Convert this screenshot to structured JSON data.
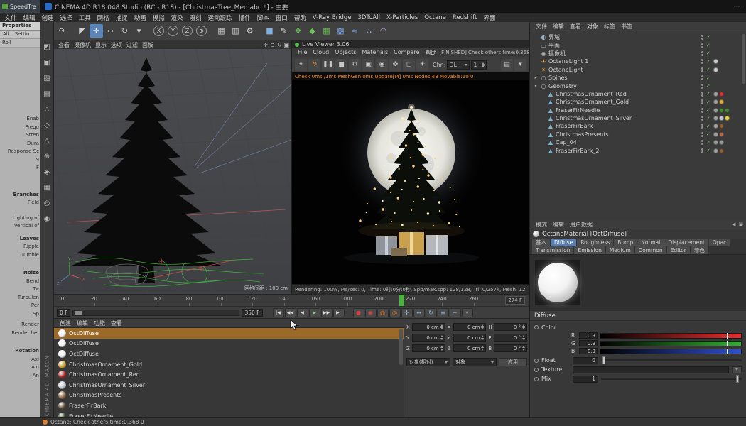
{
  "titlebar": {
    "speedtree_title": "SpeedTre",
    "title": "CINEMA 4D R18.048 Studio (RC - R18) - [ChristmasTree_Med.abc *] - 主要",
    "minimize": "—"
  },
  "menubar": {
    "items": [
      "文件",
      "编辑",
      "创建",
      "选择",
      "工具",
      "网格",
      "捕捉",
      "动画",
      "模拟",
      "渲染",
      "雕刻",
      "运动跟踪",
      "插件",
      "脚本",
      "窗口",
      "帮助",
      "V-Ray Bridge",
      "3DToAll",
      "X-Particles",
      "Octane",
      "Redshift",
      "界面"
    ]
  },
  "toolbar": {
    "icons": [
      {
        "name": "undo-icon",
        "glyph": "↶"
      },
      {
        "name": "redo-icon",
        "glyph": "↷"
      },
      {
        "sep": true
      },
      {
        "name": "live-selection-tool",
        "glyph": "◤"
      },
      {
        "name": "move-tool",
        "glyph": "✛",
        "active": true
      },
      {
        "name": "scale-tool",
        "glyph": "↔"
      },
      {
        "name": "rotate-tool",
        "glyph": "↻"
      },
      {
        "name": "last-tool-used",
        "glyph": "▾"
      },
      {
        "sep": true
      },
      {
        "name": "lock-x-axis",
        "glyph": "X",
        "circle": true
      },
      {
        "name": "lock-y-axis",
        "glyph": "Y",
        "circle": true
      },
      {
        "name": "lock-z-axis",
        "glyph": "Z",
        "circle": true
      },
      {
        "name": "coordinate-system",
        "glyph": "⊕",
        "circle": true
      },
      {
        "sep": true
      },
      {
        "name": "render-view",
        "glyph": "▦"
      },
      {
        "name": "render-to-picture-viewer",
        "glyph": "▥"
      },
      {
        "name": "edit-render-settings",
        "glyph": "⚙"
      },
      {
        "sep": true
      },
      {
        "name": "add-primitive",
        "glyph": "■",
        "color": "#7fb0e0"
      },
      {
        "name": "add-spline",
        "glyph": "✎",
        "color": "#d8d8d8"
      },
      {
        "name": "add-mograph",
        "glyph": "❖",
        "color": "#6cc05a"
      },
      {
        "name": "add-fracture",
        "glyph": "◆",
        "color": "#6cc05a"
      },
      {
        "name": "add-field",
        "glyph": "▦",
        "color": "#6cc05a"
      },
      {
        "name": "add-volume",
        "glyph": "▩",
        "color": "#6f9ad8"
      },
      {
        "name": "add-simulation",
        "glyph": "≈",
        "color": "#6f9ad8"
      },
      {
        "name": "add-particles",
        "glyph": "∴",
        "color": "#9fd0ff"
      },
      {
        "name": "add-deformer",
        "glyph": "◠",
        "color": "#c8a0e0"
      }
    ]
  },
  "speedtree": {
    "header": "Properties",
    "tabs": [
      "All",
      "Settin"
    ],
    "row": "Roll",
    "labels": [
      {
        "sp": 96
      },
      {
        "t": "Enab"
      },
      {
        "t": "Frequ"
      },
      {
        "t": "Stren"
      },
      {
        "t": "Dura"
      },
      {
        "t": "Response Sc"
      },
      {
        "t": "N"
      },
      {
        "t": "F"
      },
      {
        "sp": 26
      },
      {
        "t": "Branches",
        "h": true
      },
      {
        "t": "Field"
      },
      {
        "sp": 10
      },
      {
        "t": "Lighting of"
      },
      {
        "t": "Vertical of"
      },
      {
        "sp": 6
      },
      {
        "t": "Leaves",
        "h": true
      },
      {
        "t": "Ripple"
      },
      {
        "t": "Tumble"
      },
      {
        "sp": 14
      },
      {
        "t": "Noise",
        "h": true
      },
      {
        "t": "Bend"
      },
      {
        "t": "Tw"
      },
      {
        "t": "Turbulen"
      },
      {
        "t": "Per"
      },
      {
        "t": "Sp"
      },
      {
        "sp": 4
      },
      {
        "t": "Render"
      },
      {
        "t": "Render het"
      },
      {
        "sp": 14
      },
      {
        "t": "Rotation",
        "h": true
      },
      {
        "t": "Axi"
      },
      {
        "t": "Axi"
      },
      {
        "t": "An"
      }
    ]
  },
  "palette": {
    "icons": [
      {
        "name": "make-editable-icon",
        "glyph": "◩"
      },
      {
        "name": "model-mode-icon",
        "glyph": "▣"
      },
      {
        "name": "texture-mode-icon",
        "glyph": "▨"
      },
      {
        "name": "workplane-mode-icon",
        "glyph": "▤"
      },
      {
        "name": "points-mode-icon",
        "glyph": "∴"
      },
      {
        "name": "edges-mode-icon",
        "glyph": "◇"
      },
      {
        "name": "polygons-mode-icon",
        "glyph": "△"
      },
      {
        "name": "enable-axis-icon",
        "glyph": "⊕"
      },
      {
        "name": "snap-icon",
        "glyph": "◈"
      },
      {
        "name": "locked-workplane-icon",
        "glyph": "▦"
      },
      {
        "name": "viewport-solo-off-icon",
        "glyph": "◎"
      },
      {
        "name": "viewport-solo-single-icon",
        "glyph": "◉"
      }
    ]
  },
  "branding": {
    "maxon": "MAXON",
    "c4d": "CINEMA 4D"
  },
  "viewport": {
    "menus": [
      "查看",
      "摄像机",
      "显示",
      "选项",
      "过滤",
      "面板"
    ],
    "nav": [
      {
        "name": "pan-view-icon",
        "glyph": "✛"
      },
      {
        "name": "zoom-view-icon",
        "glyph": "⊙"
      },
      {
        "name": "rotate-view-icon",
        "glyph": "↻"
      },
      {
        "name": "toggle-view-icon",
        "glyph": "▣"
      }
    ],
    "grid_label": "网格间距 : 100 cm"
  },
  "live_viewer": {
    "title": "Live Viewer 3.06",
    "menus": [
      "File",
      "Cloud",
      "Objects",
      "Materials",
      "Compare",
      "帮助"
    ],
    "status": "[FINISHED] Check others time:0.368 0",
    "toolbar_left": [
      {
        "name": "focus-picker-icon",
        "glyph": "⌖"
      },
      {
        "name": "restart-render-icon",
        "glyph": "↻",
        "color": "#e8a040"
      },
      {
        "name": "pause-render-icon",
        "glyph": "❚❚"
      },
      {
        "name": "stop-render-icon",
        "glyph": "■"
      },
      {
        "name": "render-settings-icon",
        "glyph": "⚙"
      },
      {
        "name": "lock-resolution-icon",
        "glyph": "▣"
      },
      {
        "name": "camera-icon",
        "glyph": "◉"
      },
      {
        "name": "material-picker-icon",
        "glyph": "✜"
      },
      {
        "name": "render-region-icon",
        "glyph": "◻"
      },
      {
        "name": "lightmix-icon",
        "glyph": "☀"
      }
    ],
    "chn_label": "Chn:",
    "chn_value": "DL",
    "samples": "1",
    "toolbar_right": [
      {
        "name": "save-image-icon",
        "glyph": "▤"
      },
      {
        "name": "viewer-options-icon",
        "glyph": "▾"
      }
    ],
    "stats_line": "Check 0ms /1ms   MeshGen 0ms   Update[M] 0ms   Nodes:43 Movable:10   0",
    "footer": "Rendering: 100%,  Ms/sec: 0,  Time: 0时:0分:0秒,  Spp/max.spp: 128/128,  Tri: 0/257k,  Mesh: 12"
  },
  "object_manager": {
    "menus": [
      "文件",
      "编辑",
      "查看",
      "对象",
      "标签",
      "书签"
    ],
    "objects": [
      {
        "name": "界域",
        "icon": "◐",
        "ic": "#9ab4d0",
        "tags": []
      },
      {
        "name": "平面",
        "icon": "▭",
        "ic": "#9ab4d0",
        "tags": []
      },
      {
        "name": "摄像机",
        "icon": "◉",
        "ic": "#b0b0b0",
        "tags": []
      },
      {
        "name": "OctaneLight 1",
        "icon": "☀",
        "ic": "#e8b050",
        "tags": [
          "#cccccc"
        ]
      },
      {
        "name": "OctaneLight",
        "icon": "☀",
        "ic": "#e8b050",
        "tags": [
          "#cccccc"
        ]
      },
      {
        "name": "Spines",
        "icon": "○",
        "ic": "#b0b0b0",
        "expand": "closed",
        "tags": []
      },
      {
        "name": "Geometry",
        "icon": "○",
        "ic": "#b0b0b0",
        "expand": "open",
        "tags": []
      },
      {
        "name": "ChristmasOrnament_Red",
        "icon": "▲",
        "ic": "#7fb2c8",
        "indent": 1,
        "tags": [
          "#a0a0a0",
          "#cc3838"
        ]
      },
      {
        "name": "ChristmasOrnament_Gold",
        "icon": "▲",
        "ic": "#7fb2c8",
        "indent": 1,
        "tags": [
          "#a0a0a0",
          "#d8a83a"
        ]
      },
      {
        "name": "FraserFirNeedle",
        "icon": "▲",
        "ic": "#7fb2c8",
        "indent": 1,
        "tags": [
          "#a0a0a0",
          "#4e8a3a",
          "#4e8a3a"
        ]
      },
      {
        "name": "ChristmasOrnament_Silver",
        "icon": "▲",
        "ic": "#7fb2c8",
        "indent": 1,
        "tags": [
          "#a0a0a0",
          "#c4c8d0",
          "#e8d44a"
        ]
      },
      {
        "name": "FraserFirBark",
        "icon": "▲",
        "ic": "#7fb2c8",
        "indent": 1,
        "tags": [
          "#a0a0a0",
          "#8a6038"
        ]
      },
      {
        "name": "ChristmasPresents",
        "icon": "▲",
        "ic": "#7fb2c8",
        "indent": 1,
        "tags": [
          "#a0a0a0",
          "#b06a4a"
        ]
      },
      {
        "name": "Cap_04",
        "icon": "▲",
        "ic": "#7fb2c8",
        "indent": 1,
        "tags": [
          "#a0a0a0",
          "#9a9a9a"
        ]
      },
      {
        "name": "FraserFirBark_2",
        "icon": "▲",
        "ic": "#7fb2c8",
        "indent": 1,
        "tags": [
          "#a0a0a0",
          "#8a6038"
        ]
      }
    ]
  },
  "attribute_manager": {
    "menus": [
      "模式",
      "编辑",
      "用户数据"
    ],
    "title": "OctaneMaterial [OctDiffuse]",
    "tabs_row1": [
      "基本",
      "Diffuse",
      "Roughness",
      "Bump",
      "Normal",
      "Displacement",
      "Opac"
    ],
    "tabs_row2": [
      "Transmission",
      "Emission",
      "Medium",
      "Common",
      "Editor",
      "着色"
    ],
    "active_tab": "Diffuse",
    "section": "Diffuse",
    "color_label": "Color",
    "channels": [
      {
        "label": "R",
        "value": "0.9",
        "color": "#e03030",
        "frac": 0.9
      },
      {
        "label": "G",
        "value": "0.9",
        "color": "#30b030",
        "frac": 0.9
      },
      {
        "label": "B",
        "value": "0.9",
        "color": "#3050d0",
        "frac": 0.9
      }
    ],
    "float_label": "Float",
    "float_value": "0",
    "texture_label": "Texture",
    "mix_label": "Mix",
    "mix_value": "1"
  },
  "timeline": {
    "ticks": [
      "0",
      "20",
      "40",
      "60",
      "80",
      "100",
      "120",
      "140",
      "160",
      "180",
      "200",
      "220",
      "240",
      "260"
    ],
    "end_label": "274 F",
    "marker_frac": 0.78,
    "range_start": "0 F",
    "range_end": "350 F",
    "transport": [
      {
        "name": "goto-start-button",
        "glyph": "|◀"
      },
      {
        "name": "prev-key-button",
        "glyph": "◀◀"
      },
      {
        "name": "prev-frame-button",
        "glyph": "◀"
      },
      {
        "name": "play-button",
        "glyph": "▶",
        "color": "#8fd08f"
      },
      {
        "name": "next-frame-button",
        "glyph": "▶▶"
      },
      {
        "name": "goto-end-button",
        "glyph": "▶|"
      }
    ],
    "record_icons": [
      {
        "name": "record-keyframe-button",
        "glyph": "●",
        "color": "#cc4444"
      },
      {
        "name": "autokeying-button",
        "glyph": "◉",
        "color": "#cc4444"
      },
      {
        "name": "octane-refresh-button",
        "glyph": "◍",
        "color": "#e07828"
      },
      {
        "name": "octane-live-button",
        "glyph": "◎",
        "color": "#e07828"
      },
      {
        "name": "key-position-toggle",
        "glyph": "✛",
        "color": "#8fb0d8"
      },
      {
        "name": "key-scale-toggle",
        "glyph": "↔",
        "color": "#8fb0d8"
      },
      {
        "name": "key-rotation-toggle",
        "glyph": "↻",
        "color": "#8fb0d8"
      },
      {
        "name": "key-parameter-toggle",
        "glyph": "≡",
        "color": "#8fb0d8"
      },
      {
        "name": "key-pla-toggle",
        "glyph": "~",
        "color": "#8fb0d8"
      },
      {
        "name": "playback-options-button",
        "glyph": "▾",
        "color": "#aaaaaa"
      }
    ]
  },
  "material_manager": {
    "menus": [
      "创建",
      "编辑",
      "功能",
      "查看"
    ],
    "materials": [
      {
        "name": "OctDiffuse",
        "color": "#f0f0f0",
        "selected": true
      },
      {
        "name": "OctDiffuse",
        "color": "#f0f0f0"
      },
      {
        "name": "OctDiffuse",
        "color": "#f0f0f0"
      },
      {
        "name": "ChristmasOrnament_Gold",
        "color": "#c8a030"
      },
      {
        "name": "ChristmasOrnament_Red",
        "color": "#a82424"
      },
      {
        "name": "ChristmasOrnament_Silver",
        "color": "#c0c4cc"
      },
      {
        "name": "ChristmasPresents",
        "color": "#8a6a48"
      },
      {
        "name": "FraserFirBark",
        "color": "#5a4632"
      },
      {
        "name": "FraserFirNeedle",
        "color": "#2e4420"
      }
    ]
  },
  "coordinates": {
    "cols": [
      {
        "name": "position",
        "rows": [
          [
            "X",
            "0 cm"
          ],
          [
            "Y",
            "0 cm"
          ],
          [
            "Z",
            "0 cm"
          ]
        ]
      },
      {
        "name": "size",
        "rows": [
          [
            "X",
            "0 cm"
          ],
          [
            "Y",
            "0 cm"
          ],
          [
            "Z",
            "0 cm"
          ]
        ]
      },
      {
        "name": "rotation",
        "rows": [
          [
            "H",
            "0 °"
          ],
          [
            "P",
            "0 °"
          ],
          [
            "B",
            "0 °"
          ]
        ]
      }
    ],
    "dropdown1": "对象(相对)",
    "dropdown2": "对象",
    "apply": "应用"
  },
  "statusbar": {
    "text": "Octane: Check others time:0.368 0"
  }
}
